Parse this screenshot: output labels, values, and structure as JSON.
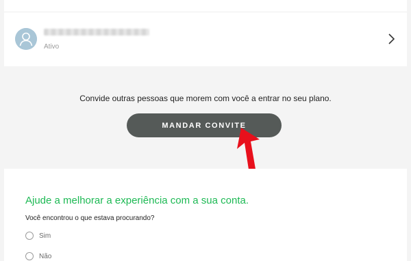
{
  "member": {
    "name": "",
    "status": "Ativo"
  },
  "invite": {
    "text": "Convide outras pessoas que morem com você a entrar no seu plano.",
    "button_label": "MANDAR CONVITE"
  },
  "feedback": {
    "title": "Ajude a melhorar a experiência com a sua conta.",
    "question": "Você encontrou o que estava procurando?",
    "options": [
      {
        "label": "Sim"
      },
      {
        "label": "Não"
      }
    ]
  },
  "colors": {
    "accent_green": "#1db954",
    "button_bg": "#555a58",
    "annotation_arrow": "#e8101c",
    "avatar_bg": "#a9c6d7"
  },
  "icons": {
    "avatar": "user-avatar-icon",
    "chevron": "chevron-right-icon",
    "arrow": "red-arrow-annotation-icon"
  }
}
